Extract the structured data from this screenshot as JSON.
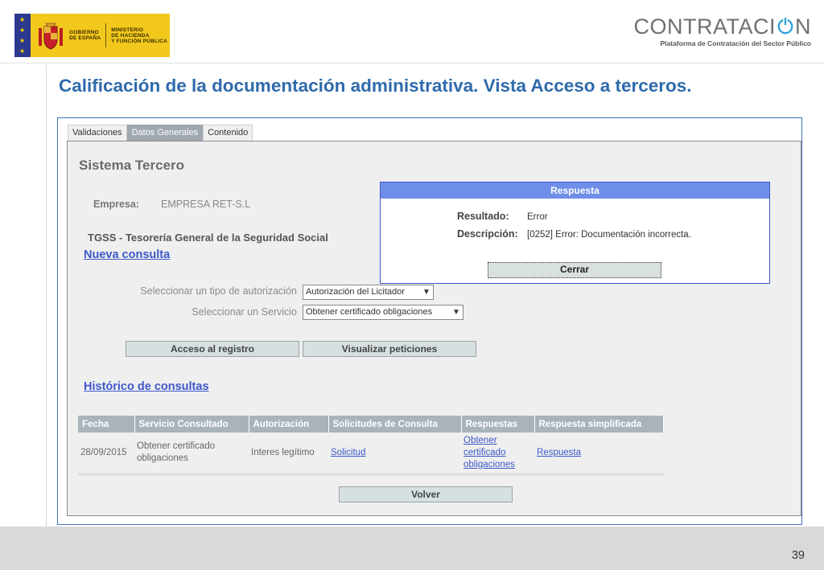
{
  "header": {
    "gov_logo": {
      "line1": "GOBIERNO",
      "line2": "DE ESPAÑA",
      "ministry_line1": "MINISTERIO",
      "ministry_line2": "DE HACIENDA",
      "ministry_line3": "Y FUNCIÓN PÚBLICA"
    },
    "brand_name": "CONTRATACI",
    "brand_name_end": "N",
    "brand_subtitle": "Plataforma de Contratación del Sector Público"
  },
  "slide_title": "Calificación de la documentación administrativa. Vista Acceso a terceros.",
  "tabs": [
    {
      "label": "Validaciones",
      "active": false
    },
    {
      "label": "Datos Generales",
      "active": true
    },
    {
      "label": "Contenido",
      "active": false
    }
  ],
  "panel": {
    "title": "Sistema Tercero",
    "empresa_label": "Empresa:",
    "empresa_value": "EMPRESA RET-S.L",
    "tgss": "TGSS - Tesorería General de la Seguridad Social",
    "nueva_consulta": "Nueva consulta",
    "tipo_autorizacion_label": "Seleccionar un tipo de autorización",
    "tipo_autorizacion_value": "Autorización del Licitador",
    "servicio_label": "Seleccionar un Servicio",
    "servicio_value": "Obtener certificado obligaciones",
    "acceso_button": "Acceso al registro",
    "visualizar_button": "Visualizar peticiones",
    "historico": "Histórico de consultas",
    "volver_button": "Volver"
  },
  "table": {
    "headers": [
      "Fecha",
      "Servicio Consultado",
      "Autorización",
      "Solicitudes de Consulta",
      "Respuestas",
      "Respuesta simplificada"
    ],
    "rows": [
      {
        "fecha": "28/09/2015",
        "servicio_l1": "Obtener certificado",
        "servicio_l2": "obligaciones",
        "autorizacion": "Interes legítimo",
        "solicitud": "Solicitud",
        "respuesta_l1": "Obtener",
        "respuesta_l2": "certificado",
        "respuesta_l3": "obligaciones",
        "respuesta_simplificada": "Respuesta"
      }
    ]
  },
  "dialog": {
    "title": "Respuesta",
    "resultado_label": "Resultado:",
    "resultado_value": "Error",
    "descripcion_label": "Descripción:",
    "descripcion_value": "[0252] Error: Documentación incorrecta.",
    "close_button": "Cerrar"
  },
  "footer": {
    "page_number": "39"
  },
  "colors": {
    "title_blue": "#2e6aab",
    "link_blue": "#3d59c9",
    "dialog_header": "#6f8ee8",
    "tab_active": "#9fa7b0",
    "table_header": "#a9b3b9"
  }
}
